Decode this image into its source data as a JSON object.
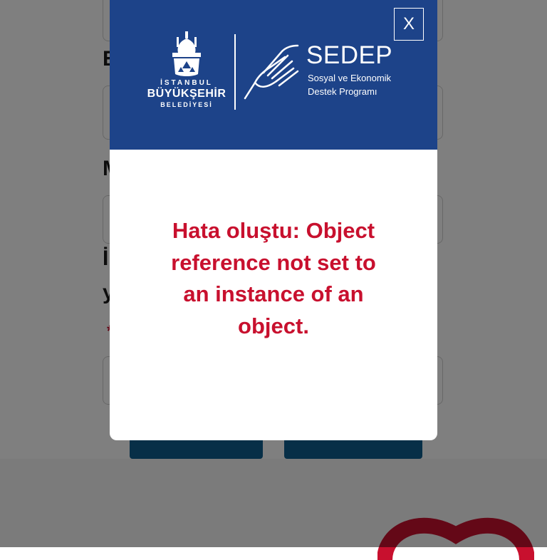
{
  "background": {
    "labels": [
      "E",
      "M",
      "İ",
      "y",
      "*"
    ]
  },
  "modal": {
    "close_label": "X",
    "logo": {
      "line1": "İSTANBUL",
      "line2": "BÜYÜKŞEHİR",
      "line3": "BELEDİYESİ"
    },
    "brand": {
      "title": "SEDEP",
      "subtitle_line1": "Sosyal ve Ekonomik",
      "subtitle_line2": "Destek Programı"
    },
    "error_message": "Hata oluştu: Object reference not set to an instance of an object."
  },
  "colors": {
    "header_blue": "#1d4389",
    "error_red": "#c8102e",
    "button_blue": "#0f5f8f",
    "overlay": "rgba(0,0,0,0.5)"
  }
}
